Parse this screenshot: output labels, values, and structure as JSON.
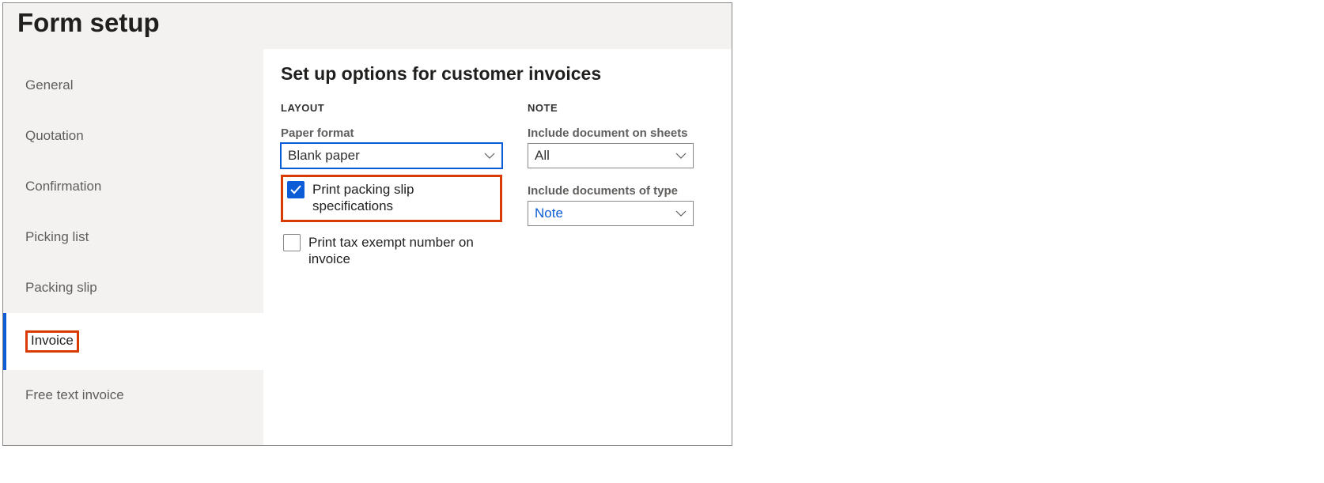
{
  "title": "Form setup",
  "sidebar": {
    "items": [
      {
        "label": "General"
      },
      {
        "label": "Quotation"
      },
      {
        "label": "Confirmation"
      },
      {
        "label": "Picking list"
      },
      {
        "label": "Packing slip"
      },
      {
        "label": "Invoice"
      },
      {
        "label": "Free text invoice"
      }
    ],
    "active_index": 5,
    "highlighted_index": 5
  },
  "content": {
    "heading": "Set up options for customer invoices",
    "layout": {
      "section_label": "LAYOUT",
      "paper_format": {
        "label": "Paper format",
        "value": "Blank paper"
      },
      "print_packing_slip": {
        "label": "Print packing slip specifications",
        "checked": true,
        "highlighted": true
      },
      "print_tax_exempt": {
        "label": "Print tax exempt number on invoice",
        "checked": false
      }
    },
    "note": {
      "section_label": "NOTE",
      "include_on_sheets": {
        "label": "Include document on sheets",
        "value": "All"
      },
      "include_of_type": {
        "label": "Include documents of type",
        "value": "Note"
      }
    }
  }
}
